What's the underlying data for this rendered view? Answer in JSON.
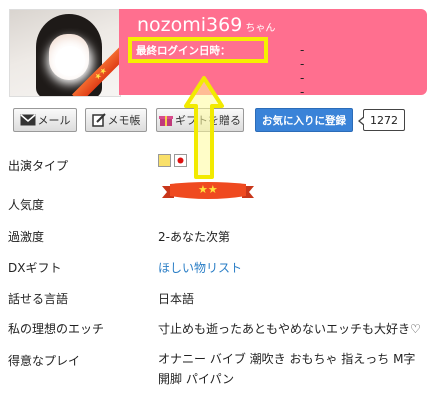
{
  "profile": {
    "name": "nozomi369",
    "honorific": "ちゃん",
    "last_login_label": "最終ログイン日時：",
    "last_login_value": "----",
    "photo_ribbon_stars": "★★"
  },
  "actions": {
    "mail_label": "メール",
    "memo_label": "メモ帳",
    "gift_label": "ギフトを贈る",
    "favorite_label": "お気に入りに登録",
    "favorite_count": "1272"
  },
  "info": {
    "rows": [
      {
        "label": "出演タイプ",
        "value": ""
      },
      {
        "label": "人気度",
        "value": ""
      },
      {
        "label": "過激度",
        "value": "2-あなた次第"
      },
      {
        "label": "DXギフト",
        "value": "ほしい物リスト"
      },
      {
        "label": "話せる言語",
        "value": "日本語"
      },
      {
        "label": "私の理想のエッチ",
        "value": "寸止めも逝ったあともやめないエッチも大好き♡"
      },
      {
        "label": "得意なプレイ",
        "value": "オナニー バイブ 潮吹き おもちゃ 指えっち M字開脚 パイパン"
      }
    ],
    "popularity_stars": "★★"
  },
  "colors": {
    "banner": "#ff6f8f",
    "highlight_box": "#f6f000",
    "favorite_button": "#3a83d8",
    "link": "#2a7ec6"
  },
  "icons": [
    "mail-icon",
    "memo-icon",
    "gift-icon",
    "arrow-up-annotation",
    "ribbon-icon",
    "flag-icon"
  ]
}
